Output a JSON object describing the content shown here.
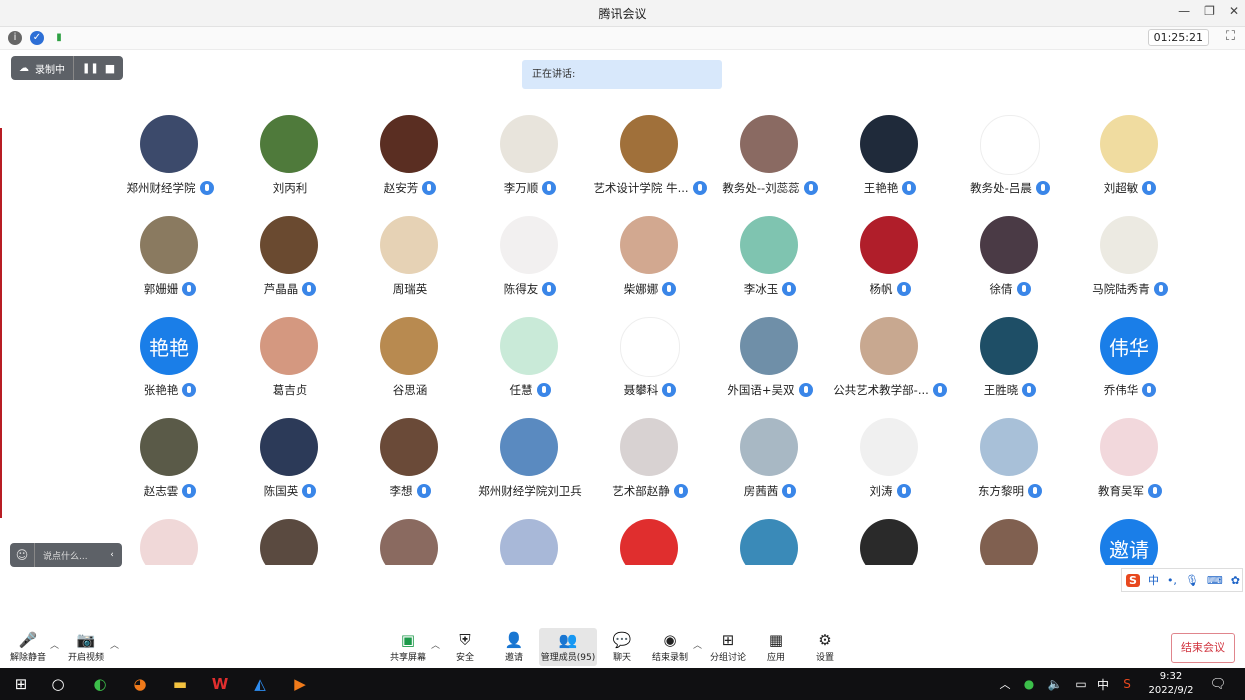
{
  "window": {
    "title": "腾讯会议"
  },
  "meeting": {
    "timer": "01:25:21",
    "speaking_label": "正在讲话:"
  },
  "recording": {
    "label": "录制中"
  },
  "chat": {
    "placeholder": "说点什么..."
  },
  "participants": [
    {
      "name": "郑州财经学院",
      "avatar_text": "",
      "color": "#3c4a6b",
      "mic": true
    },
    {
      "name": "刘丙利",
      "avatar_text": "",
      "color": "#4f7a3b",
      "mic": false
    },
    {
      "name": "赵安芳",
      "avatar_text": "",
      "color": "#5a2e22",
      "mic": true
    },
    {
      "name": "李万顺",
      "avatar_text": "",
      "color": "#e8e4dc",
      "mic": true
    },
    {
      "name": "艺术设计学院  牛...",
      "avatar_text": "",
      "color": "#a0703a",
      "mic": true
    },
    {
      "name": "教务处--刘蕊蕊",
      "avatar_text": "",
      "color": "#8a6a62",
      "mic": true
    },
    {
      "name": "王艳艳",
      "avatar_text": "",
      "color": "#1f2a3a",
      "mic": true
    },
    {
      "name": "教务处-吕晨",
      "avatar_text": "",
      "color": "#ffffff",
      "mic": true
    },
    {
      "name": "刘超敏",
      "avatar_text": "",
      "color": "#f0dca0",
      "mic": true
    },
    {
      "name": "郭姗姗",
      "avatar_text": "",
      "color": "#8a7a60",
      "mic": true
    },
    {
      "name": "芦晶晶",
      "avatar_text": "",
      "color": "#6a4a30",
      "mic": true
    },
    {
      "name": "周瑞英",
      "avatar_text": "",
      "color": "#e6d2b5",
      "mic": false
    },
    {
      "name": "陈得友",
      "avatar_text": "",
      "color": "#f2f0f0",
      "mic": true
    },
    {
      "name": "柴娜娜",
      "avatar_text": "",
      "color": "#d2a890",
      "mic": true
    },
    {
      "name": "李冰玉",
      "avatar_text": "",
      "color": "#7fc4b0",
      "mic": true
    },
    {
      "name": "杨帆",
      "avatar_text": "",
      "color": "#b01e2a",
      "mic": true
    },
    {
      "name": "徐倩",
      "avatar_text": "",
      "color": "#4a3a45",
      "mic": true
    },
    {
      "name": "马院陆秀青",
      "avatar_text": "",
      "color": "#eceae2",
      "mic": true
    },
    {
      "name": "张艳艳",
      "avatar_text": "艳艳",
      "color": "#1a7ee8",
      "mic": true
    },
    {
      "name": "葛吉贞",
      "avatar_text": "",
      "color": "#d49880",
      "mic": false
    },
    {
      "name": "谷思涵",
      "avatar_text": "",
      "color": "#b88a50",
      "mic": false
    },
    {
      "name": "任慧",
      "avatar_text": "",
      "color": "#c9ead8",
      "mic": true
    },
    {
      "name": "聂攀科",
      "avatar_text": "",
      "color": "#ffffff",
      "mic": true
    },
    {
      "name": "外国语+吴双",
      "avatar_text": "",
      "color": "#6f8fa8",
      "mic": true
    },
    {
      "name": "公共艺术教学部-...",
      "avatar_text": "",
      "color": "#c8a890",
      "mic": true
    },
    {
      "name": "王胜晓",
      "avatar_text": "",
      "color": "#1e4e66",
      "mic": true
    },
    {
      "name": "乔伟华",
      "avatar_text": "伟华",
      "color": "#1a7ee8",
      "mic": true
    },
    {
      "name": "赵志雲",
      "avatar_text": "",
      "color": "#5a5a48",
      "mic": true
    },
    {
      "name": "陈国英",
      "avatar_text": "",
      "color": "#2c3a58",
      "mic": true
    },
    {
      "name": "李想",
      "avatar_text": "",
      "color": "#6a4a38",
      "mic": true
    },
    {
      "name": "郑州财经学院刘卫兵",
      "avatar_text": "",
      "color": "#5a8ac0",
      "mic": false
    },
    {
      "name": "艺术部赵静",
      "avatar_text": "",
      "color": "#d8d2d2",
      "mic": true
    },
    {
      "name": "房茜茜",
      "avatar_text": "",
      "color": "#a8b8c4",
      "mic": true
    },
    {
      "name": "刘涛",
      "avatar_text": "",
      "color": "#f0f0f0",
      "mic": true
    },
    {
      "name": "东方黎明",
      "avatar_text": "",
      "color": "#a8c0d8",
      "mic": true
    },
    {
      "name": "教育吴军",
      "avatar_text": "",
      "color": "#f2d8dc",
      "mic": true
    },
    {
      "name": "",
      "avatar_text": "",
      "color": "#f0d8d8",
      "mic": false
    },
    {
      "name": "",
      "avatar_text": "",
      "color": "#5a4a40",
      "mic": false
    },
    {
      "name": "",
      "avatar_text": "",
      "color": "#8a6a60",
      "mic": false
    },
    {
      "name": "",
      "avatar_text": "",
      "color": "#a8b8d8",
      "mic": false
    },
    {
      "name": "",
      "avatar_text": "",
      "color": "#e02e2e",
      "mic": false
    },
    {
      "name": "",
      "avatar_text": "",
      "color": "#3a8ab8",
      "mic": false
    },
    {
      "name": "",
      "avatar_text": "",
      "color": "#2a2a2a",
      "mic": false
    },
    {
      "name": "",
      "avatar_text": "",
      "color": "#806050",
      "mic": false
    },
    {
      "name": "",
      "avatar_text": "邀请",
      "color": "#1a7ee8",
      "mic": false
    }
  ],
  "toolbar": {
    "unmute": "解除静音",
    "start_video": "开启视频",
    "share_screen": "共享屏幕",
    "security": "安全",
    "invite": "邀请",
    "manage_members": "管理成员(95)",
    "chat": "聊天",
    "stop_recording": "结束录制",
    "breakout": "分组讨论",
    "apps": "应用",
    "settings": "设置",
    "end_meeting": "结束会议"
  },
  "ime": {
    "lang": "中"
  },
  "taskbar": {
    "time": "9:32",
    "date": "2022/9/2",
    "lang": "中"
  },
  "colors": {
    "accent": "#1a7ee8",
    "end_red": "#d0313c",
    "taskbar": "#101012"
  }
}
